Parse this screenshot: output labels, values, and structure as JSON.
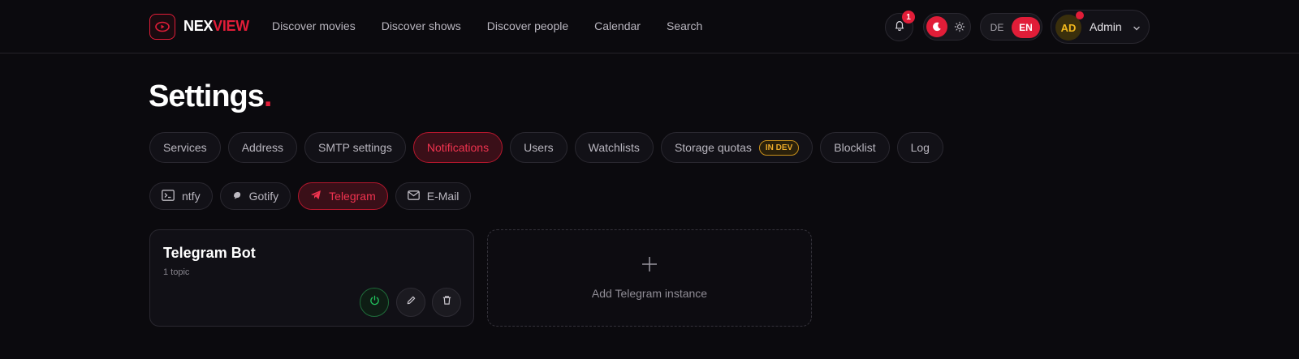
{
  "header": {
    "brand_part1": "NEX",
    "brand_part2": "VIEW",
    "nav": [
      {
        "label": "Discover movies"
      },
      {
        "label": "Discover shows"
      },
      {
        "label": "Discover people"
      },
      {
        "label": "Calendar"
      },
      {
        "label": "Search"
      }
    ],
    "notification_count": "1",
    "theme": {
      "active": "dark",
      "icons": [
        "moon-icon",
        "sun-icon"
      ]
    },
    "languages": {
      "de": "DE",
      "en": "EN",
      "active": "EN"
    },
    "user": {
      "initials": "AD",
      "name": "Admin"
    }
  },
  "page": {
    "title": "Settings",
    "title_dot": "."
  },
  "tabs": [
    {
      "label": "Services"
    },
    {
      "label": "Address"
    },
    {
      "label": "SMTP settings"
    },
    {
      "label": "Notifications",
      "active": true
    },
    {
      "label": "Users"
    },
    {
      "label": "Watchlists"
    },
    {
      "label": "Storage quotas",
      "badge": "IN DEV"
    },
    {
      "label": "Blocklist"
    },
    {
      "label": "Log"
    }
  ],
  "subtabs": [
    {
      "label": "ntfy",
      "icon": "terminal-icon"
    },
    {
      "label": "Gotify",
      "icon": "gotify-icon"
    },
    {
      "label": "Telegram",
      "icon": "telegram-icon",
      "active": true
    },
    {
      "label": "E-Mail",
      "icon": "mail-icon"
    }
  ],
  "instance": {
    "title": "Telegram Bot",
    "subtitle": "1 topic",
    "actions": [
      "power-icon",
      "pencil-icon",
      "trash-icon"
    ]
  },
  "add_instance": {
    "label": "Add Telegram instance"
  },
  "colors": {
    "accent": "#e11d38",
    "background": "#0b0a0e",
    "success": "#22c55e",
    "warning": "#eaa92a"
  }
}
